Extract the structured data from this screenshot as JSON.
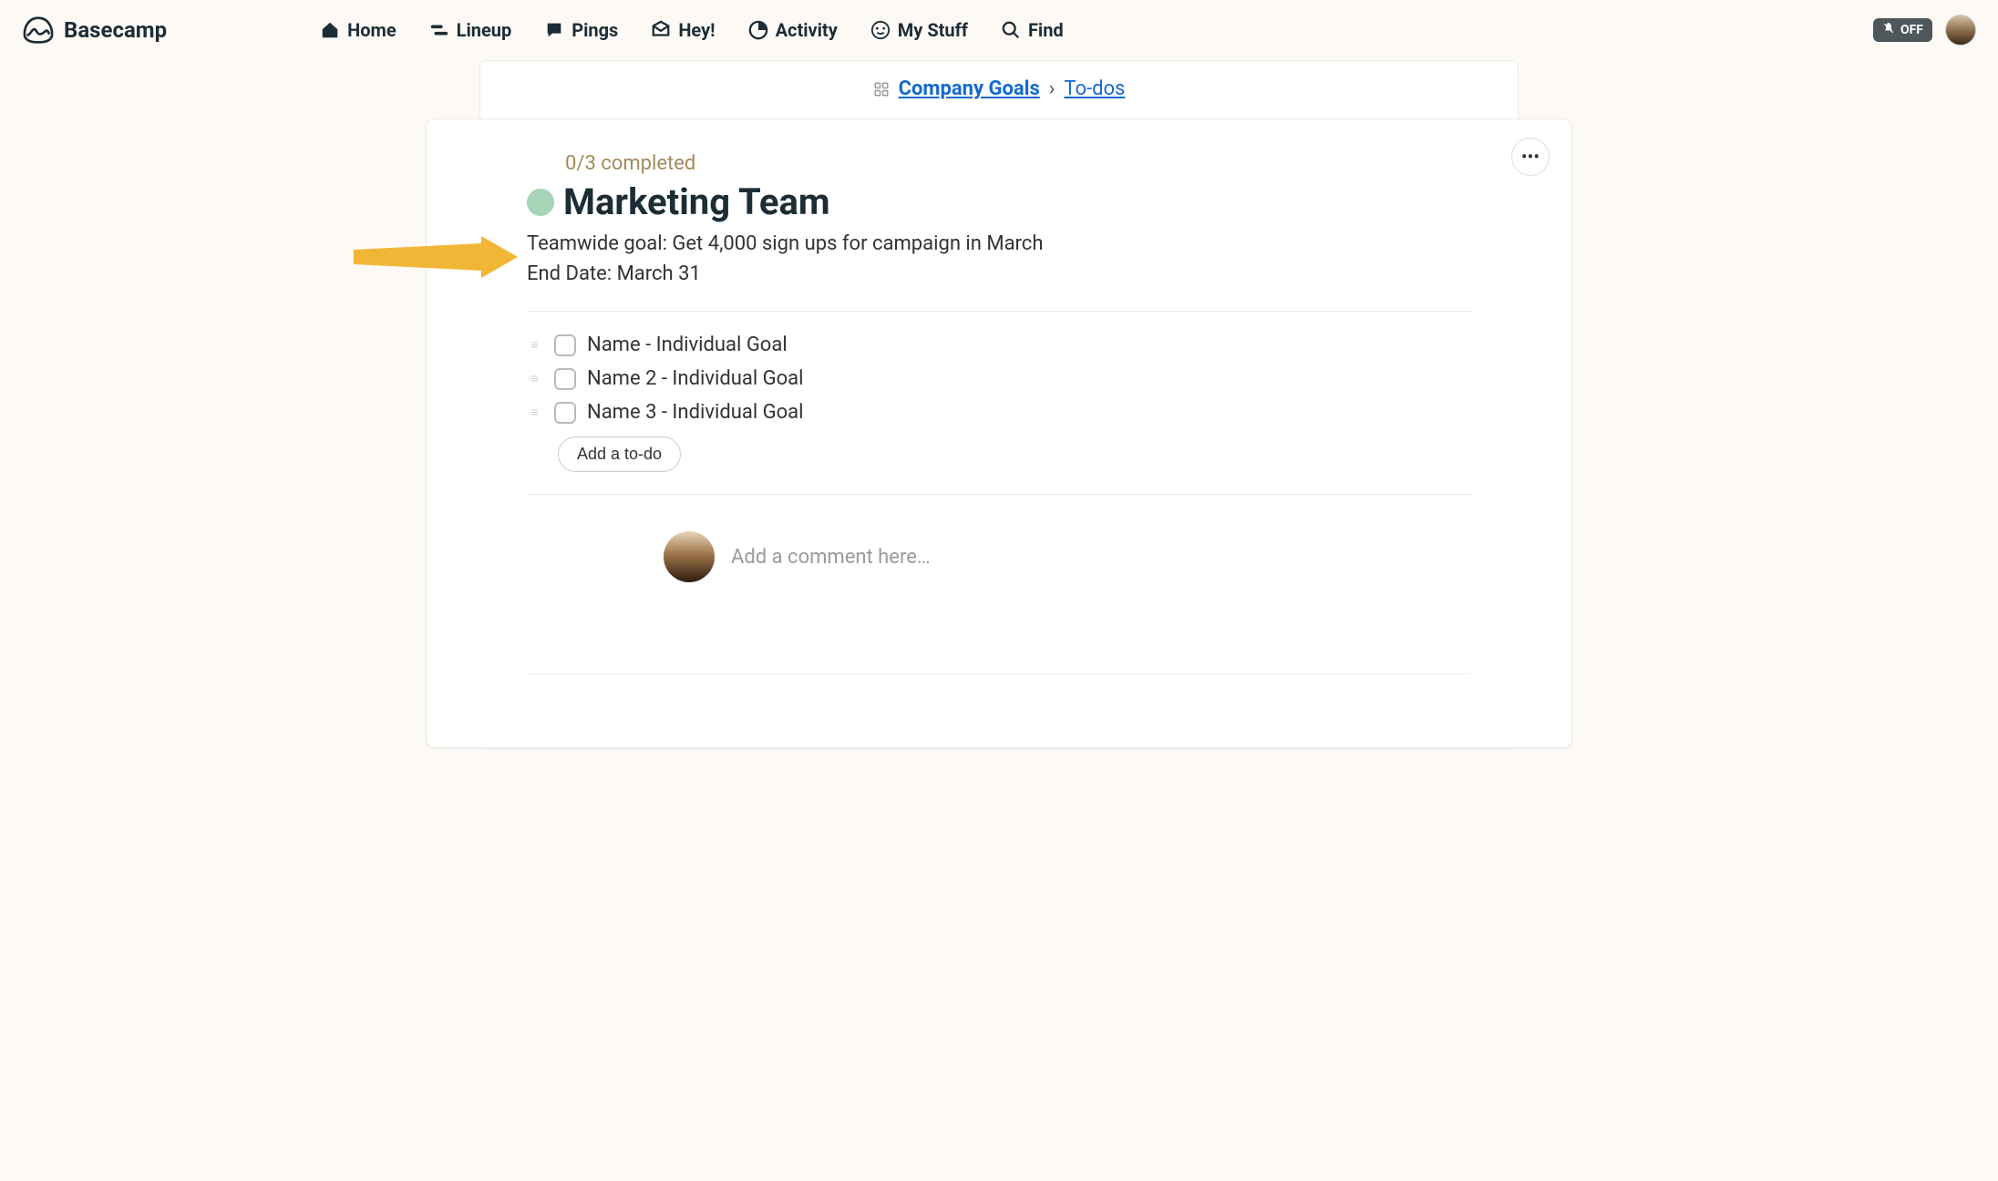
{
  "brand": {
    "name": "Basecamp"
  },
  "nav": {
    "home": "Home",
    "lineup": "Lineup",
    "pings": "Pings",
    "hey": "Hey!",
    "activity": "Activity",
    "mystuff": "My Stuff",
    "find": "Find"
  },
  "notifications": {
    "label": "OFF"
  },
  "breadcrumb": {
    "project": "Company Goals",
    "section": "To-dos"
  },
  "list": {
    "completed": "0/3 completed",
    "title": "Marketing Team",
    "description_line1": "Teamwide goal: Get 4,000 sign ups for campaign in March",
    "description_line2": "End Date: March 31",
    "todos": [
      {
        "label": "Name - Individual Goal"
      },
      {
        "label": "Name 2 - Individual Goal"
      },
      {
        "label": "Name 3 - Individual Goal"
      }
    ],
    "add_button": "Add a to-do"
  },
  "comment": {
    "placeholder": "Add a comment here…"
  }
}
